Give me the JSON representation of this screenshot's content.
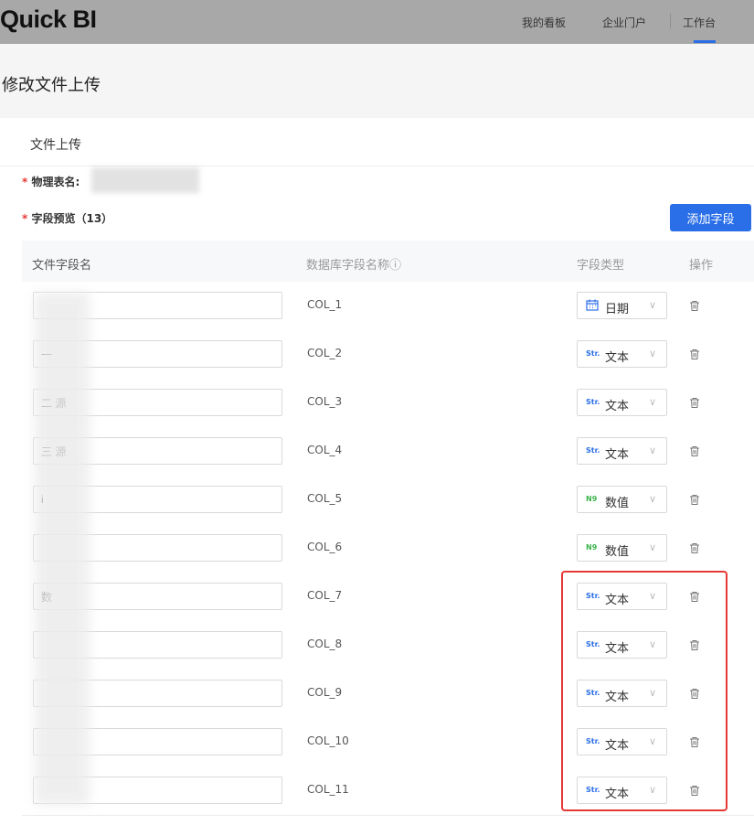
{
  "app": {
    "logo": "Quick BI"
  },
  "nav": {
    "items": [
      "我的看板",
      "企业门户",
      "工作台"
    ],
    "active": "工作台"
  },
  "page": {
    "title": "修改文件上传",
    "card_title": "文件上传"
  },
  "form": {
    "required_mark": "*",
    "table_name_label": "物理表名:",
    "field_preview_label": "字段预览（13）",
    "add_field_label": "添加字段"
  },
  "table": {
    "headers": [
      "文件字段名",
      "数据库字段名称ⓘ",
      "字段类型",
      "操作"
    ],
    "rows": [
      {
        "file_field": "",
        "db_field": "COL_1",
        "type": "日期",
        "type_icon": "calendar-icon"
      },
      {
        "file_field": "一",
        "db_field": "COL_2",
        "type": "文本",
        "type_icon": "Str."
      },
      {
        "file_field": "二 源",
        "db_field": "COL_3",
        "type": "文本",
        "type_icon": "Str."
      },
      {
        "file_field": "三 源",
        "db_field": "COL_4",
        "type": "文本",
        "type_icon": "Str."
      },
      {
        "file_field": "i",
        "db_field": "COL_5",
        "type": "数值",
        "type_icon": "N9"
      },
      {
        "file_field": "",
        "db_field": "COL_6",
        "type": "数值",
        "type_icon": "N9"
      },
      {
        "file_field": "数",
        "db_field": "COL_7",
        "type": "文本",
        "type_icon": "Str."
      },
      {
        "file_field": "",
        "db_field": "COL_8",
        "type": "文本",
        "type_icon": "Str."
      },
      {
        "file_field": "",
        "db_field": "COL_9",
        "type": "文本",
        "type_icon": "Str."
      },
      {
        "file_field": "",
        "db_field": "COL_10",
        "type": "文本",
        "type_icon": "Str."
      },
      {
        "file_field": "",
        "db_field": "COL_11",
        "type": "文本",
        "type_icon": "Str."
      }
    ]
  },
  "colors": {
    "primary": "#2a6ee8",
    "highlight": "#e53935",
    "text_type_icon": "#2a6ee8",
    "number_type_icon": "#3cb44b",
    "calendar_icon": "#2a6ee8"
  }
}
